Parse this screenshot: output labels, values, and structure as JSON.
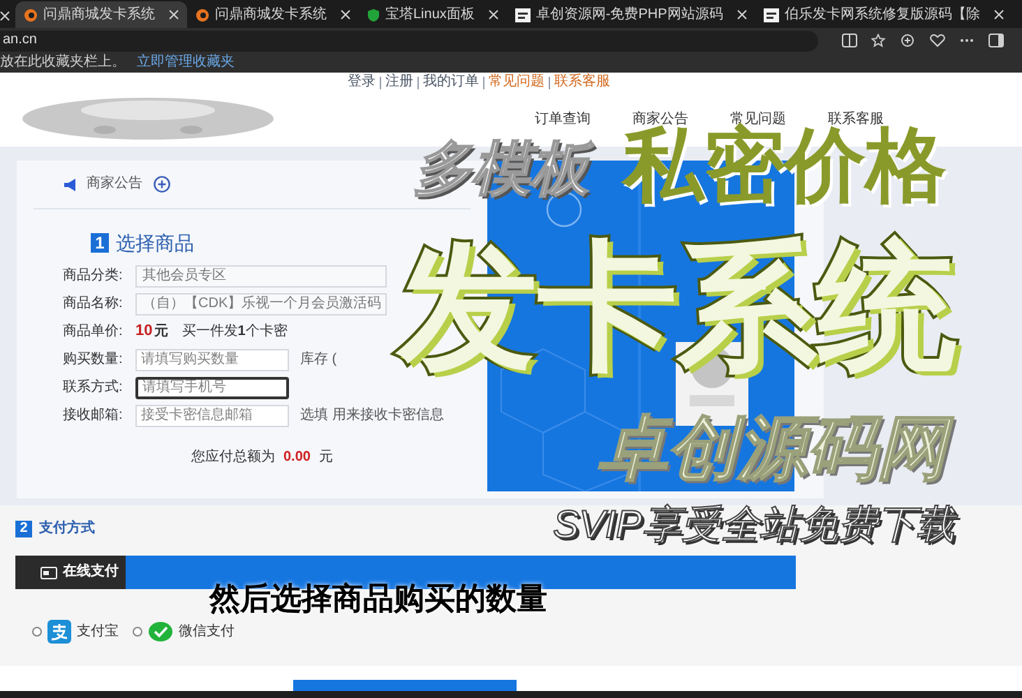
{
  "browser": {
    "tabs": [
      {
        "title": "问鼎商城发卡系统",
        "kind": "edge",
        "selected": true
      },
      {
        "title": "问鼎商城发卡系统",
        "kind": "edge",
        "selected": false
      },
      {
        "title": "宝塔Linux面板",
        "kind": "shield",
        "selected": false
      },
      {
        "title": "卓创资源网-免费PHP网站源码",
        "kind": "site",
        "selected": false
      },
      {
        "title": "伯乐发卡网系统修复版源码【除",
        "kind": "site",
        "selected": false
      }
    ],
    "address": "an.cn",
    "favorites_bar": {
      "hint": "放在此收藏夹栏上。",
      "link": "立即管理收藏夹"
    }
  },
  "top_links": [
    {
      "label": "登录",
      "highlight": false
    },
    {
      "label": "注册",
      "highlight": false
    },
    {
      "label": "我的订单",
      "highlight": false
    },
    {
      "label": "常见问题",
      "highlight": true
    },
    {
      "label": "联系客服",
      "highlight": true
    }
  ],
  "nav": [
    "订单查询",
    "商家公告",
    "常见问题",
    "联系客服"
  ],
  "notice": {
    "label": "商家公告"
  },
  "step1": {
    "number": "1",
    "title": "选择商品",
    "rows": [
      {
        "kind": "select",
        "label": "商品分类:",
        "value": "其他会员专区"
      },
      {
        "kind": "select",
        "label": "商品名称:",
        "value": "（自）【CDK】乐视一个月会员激活码"
      },
      {
        "kind": "price",
        "label": "商品单价:",
        "price": "10",
        "unit": "元",
        "note": "买一件发**1**个卡密"
      },
      {
        "kind": "input",
        "label": "购买数量:",
        "placeholder": "请填写购买数量",
        "hint": "库存 (",
        "focused": false
      },
      {
        "kind": "input",
        "label": "联系方式:",
        "placeholder": "请填写手机号",
        "focused": true
      },
      {
        "kind": "input",
        "label": "接收邮箱:",
        "placeholder": "接受卡密信息邮箱",
        "hint": "选填 用来接收卡密信息",
        "focused": false
      }
    ],
    "total": {
      "label": "您应付总额为",
      "amount": "0.00",
      "unit": "元"
    }
  },
  "step2": {
    "number": "2",
    "title": "支付方式",
    "tab": "在线支付",
    "methods": [
      {
        "kind": "alipay",
        "label": "支付宝",
        "selected": false
      },
      {
        "kind": "wechat",
        "label": "微信支付",
        "selected": false
      }
    ]
  },
  "captions": [
    {
      "kind": "white_italic",
      "text": "多模板"
    },
    {
      "kind": "olive",
      "text": "私密价格"
    },
    {
      "kind": "green_stroked",
      "text": "发卡系统"
    },
    {
      "kind": "pale",
      "text": "卓创源码网"
    },
    {
      "kind": "svip",
      "text": "SVIP享受全站免费下载"
    },
    {
      "kind": "subtitle",
      "text": "然后选择商品购买的数量"
    }
  ]
}
